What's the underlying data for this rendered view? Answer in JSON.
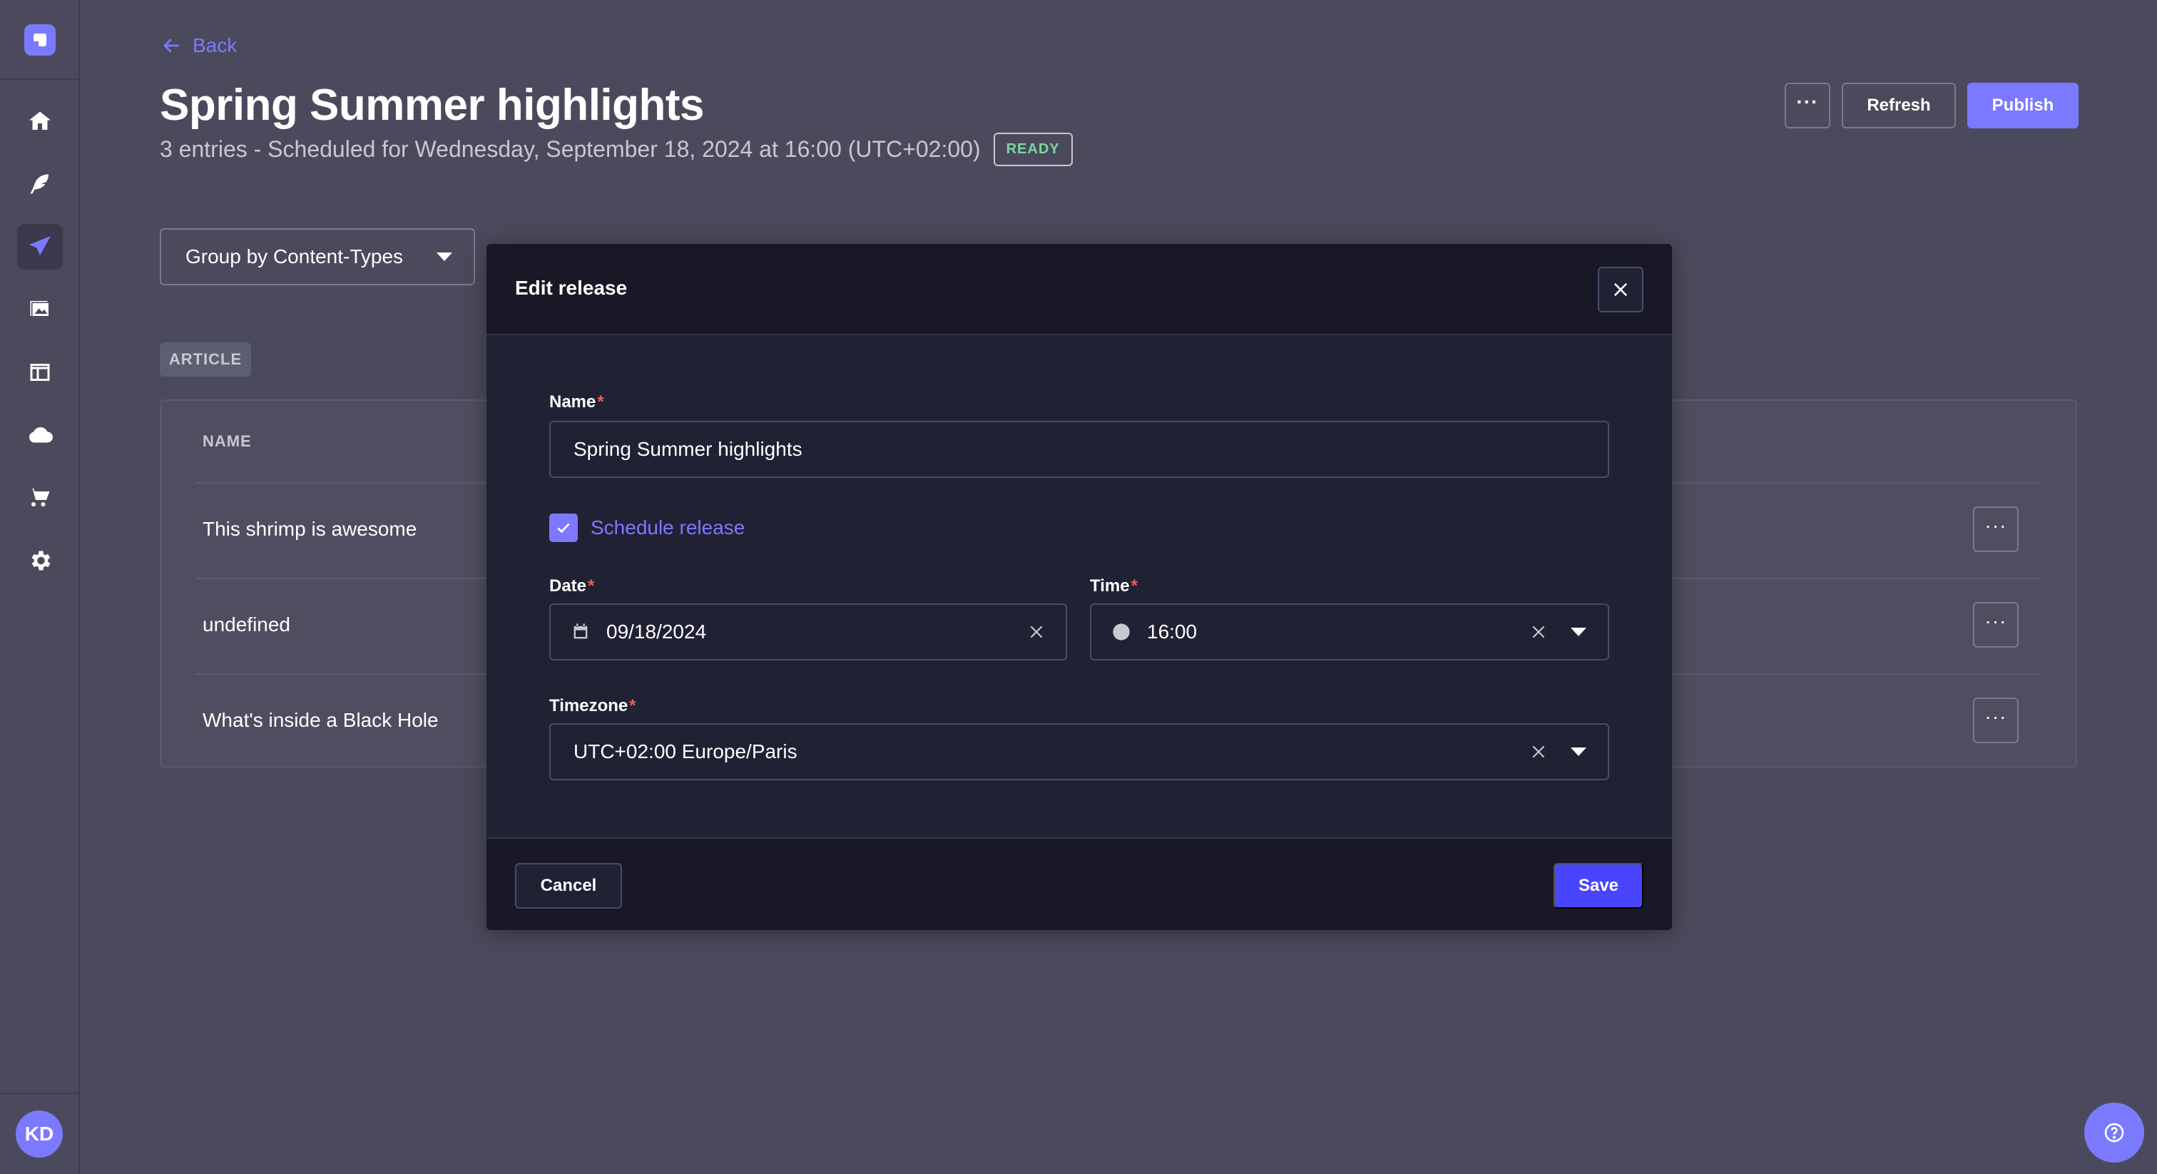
{
  "header": {
    "back_label": "Back",
    "title": "Spring Summer highlights",
    "subtitle": "3 entries - Scheduled for Wednesday, September 18, 2024 at 16:00 (UTC+02:00)",
    "status_badge": "READY",
    "more_label": "···",
    "refresh_label": "Refresh",
    "publish_label": "Publish"
  },
  "sidebar": {
    "items": [
      {
        "icon": "home-icon"
      },
      {
        "icon": "feather-icon"
      },
      {
        "icon": "paper-plane-icon",
        "active": true
      },
      {
        "icon": "images-icon"
      },
      {
        "icon": "layout-icon"
      },
      {
        "icon": "cloud-icon"
      },
      {
        "icon": "cart-icon"
      },
      {
        "icon": "gear-icon"
      }
    ],
    "avatar_initials": "KD"
  },
  "group_select": {
    "value": "Group by Content-Types"
  },
  "content_type_badge": "ARTICLE",
  "table": {
    "header_name": "NAME",
    "rows": [
      {
        "name": "This shrimp is awesome"
      },
      {
        "name": "undefined"
      },
      {
        "name": "What's inside a Black Hole"
      }
    ],
    "row_more_label": "···"
  },
  "modal": {
    "title": "Edit release",
    "name_label": "Name",
    "name_value": "Spring Summer highlights",
    "schedule_label": "Schedule release",
    "schedule_checked": true,
    "date_label": "Date",
    "date_value": "09/18/2024",
    "time_label": "Time",
    "time_value": "16:00",
    "timezone_label": "Timezone",
    "timezone_value": "UTC+02:00 Europe/Paris",
    "required_marker": "*",
    "cancel_label": "Cancel",
    "save_label": "Save"
  },
  "colors": {
    "accent": "#7b79ff",
    "primary_button": "#4945ff",
    "background": "#4a4a5c",
    "modal_background": "#212134",
    "required": "#ee5e52",
    "ready": "#7fd4a0"
  }
}
